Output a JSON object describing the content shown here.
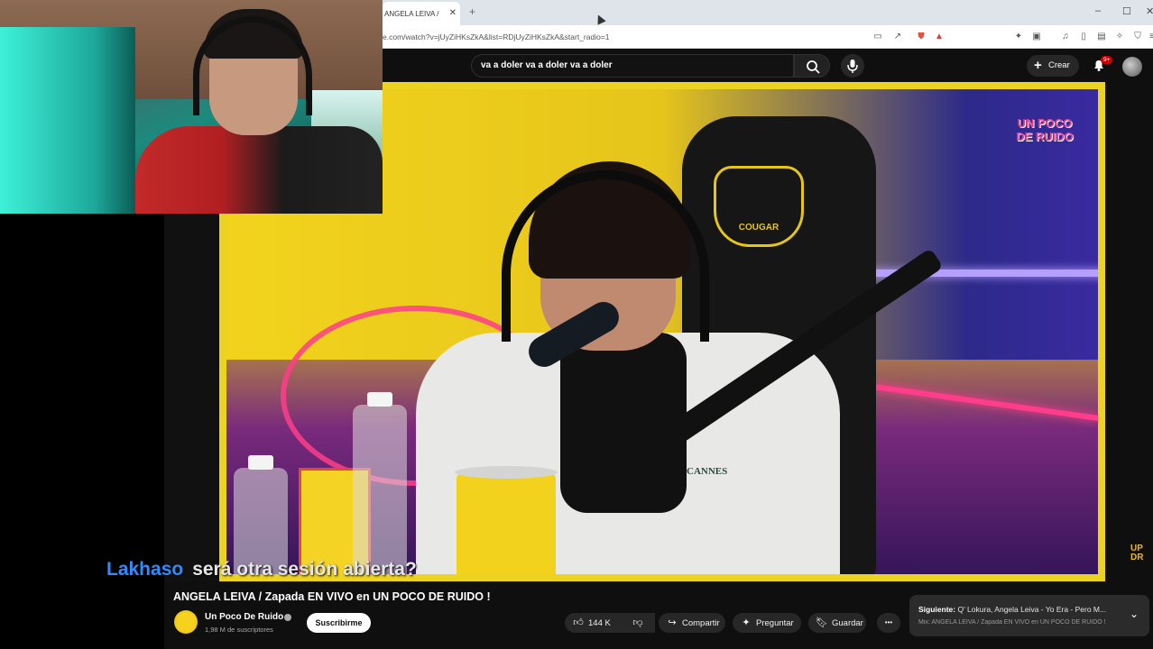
{
  "browser": {
    "tab_title": "ANGELA LEIVA / Zapada",
    "tab_close": "✕",
    "new_tab": "+",
    "url": "e.com/watch?v=jUyZiHKsZkA&list=RDjUyZiHKsZkA&start_radio=1",
    "window_min": "–",
    "window_max": "☐",
    "window_close": "✕"
  },
  "youtube": {
    "search_value": "va a doler va a doler va a doler",
    "create_label": "Crear",
    "notification_count": "9+"
  },
  "video": {
    "brand_logo_text": "UN POCO DE RUIDO",
    "chair_brand": "COUGAR",
    "hoodie_text": "CANNES",
    "corner_logo": "UP DR"
  },
  "chat": {
    "username": "Lakhaso",
    "message": "será otra sesión abierta?"
  },
  "watch": {
    "title": "ANGELA LEIVA / Zapada EN VIVO en UN POCO DE RUIDO !",
    "channel_name": "Un Poco De Ruido",
    "subscribers": "1,98 M de suscriptores",
    "subscribe_label": "Suscribirme",
    "like_count": "144 K",
    "share_label": "Compartir",
    "ask_label": "Preguntar",
    "save_label": "Guardar",
    "more_label": "•••",
    "next_prefix": "Siguiente:",
    "next_title": " Q' Lokura, Angela Leiva - Yo Era - Pero M...",
    "next_subtitle": "Mix: ANGELA LEIVA / Zapada EN VIVO en UN POCO DE RUIDO !"
  },
  "colors": {
    "youtube_bg": "#0f0f0f",
    "chat_username": "#2d8dff",
    "video_frame": "#ecd321"
  }
}
